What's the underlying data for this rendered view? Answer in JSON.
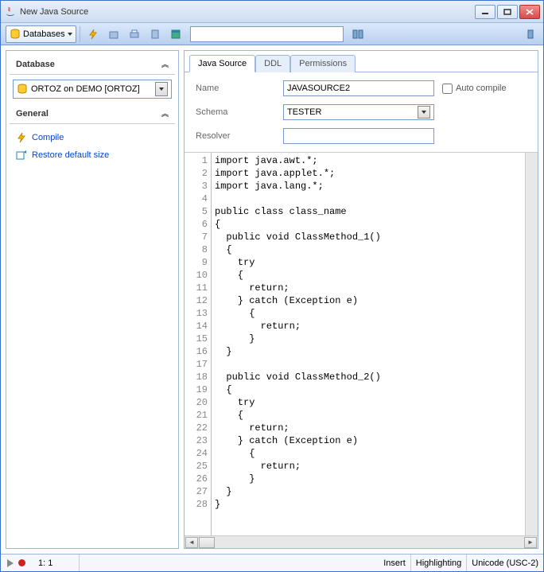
{
  "window": {
    "title": "New Java Source"
  },
  "toolbar": {
    "databases_label": "Databases"
  },
  "sidebar": {
    "sections": {
      "database": {
        "title": "Database",
        "connection": "ORTOZ on DEMO [ORTOZ]"
      },
      "general": {
        "title": "General",
        "items": [
          {
            "label": "Compile"
          },
          {
            "label": "Restore default size"
          }
        ]
      }
    }
  },
  "tabs": [
    {
      "label": "Java Source"
    },
    {
      "label": "DDL"
    },
    {
      "label": "Permissions"
    }
  ],
  "form": {
    "name_label": "Name",
    "name_value": "JAVASOURCE2",
    "schema_label": "Schema",
    "schema_value": "TESTER",
    "resolver_label": "Resolver",
    "resolver_value": "",
    "auto_compile_label": "Auto compile",
    "auto_compile_checked": false
  },
  "editor": {
    "lines": [
      "import java.awt.*;",
      "import java.applet.*;",
      "import java.lang.*;",
      "",
      "public class class_name",
      "{",
      "  public void ClassMethod_1()",
      "  {",
      "    try",
      "    {",
      "      return;",
      "    } catch (Exception e)",
      "      {",
      "        return;",
      "      }",
      "  }",
      "",
      "  public void ClassMethod_2()",
      "  {",
      "    try",
      "    {",
      "      return;",
      "    } catch (Exception e)",
      "      {",
      "        return;",
      "      }",
      "  }",
      "}"
    ]
  },
  "statusbar": {
    "cursor": "1:   1",
    "cells": [
      "Insert",
      "Highlighting",
      "Unicode (USC-2)"
    ]
  }
}
